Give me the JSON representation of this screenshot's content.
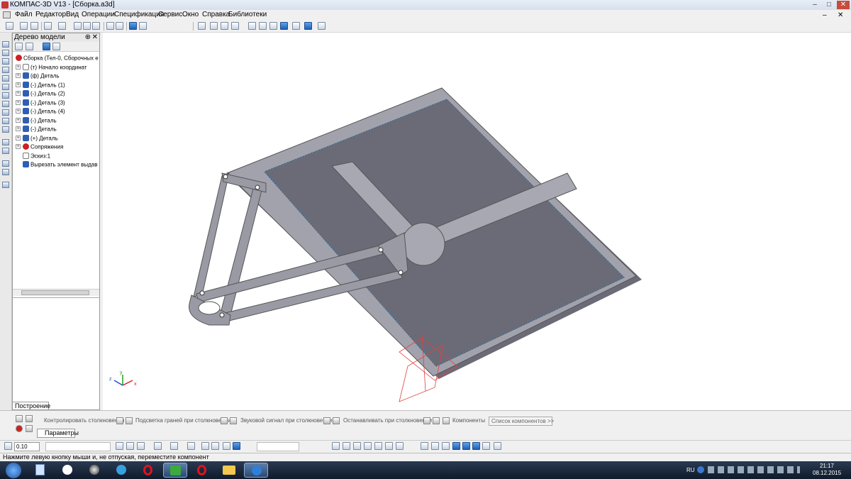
{
  "window": {
    "title": "КОМПАС-3D V13 - [Сборка.a3d]"
  },
  "menu": [
    "Файл",
    "Редактор",
    "Вид",
    "Операции",
    "Спецификация",
    "Сервис",
    "Окно",
    "Справка",
    "Библиотеки"
  ],
  "tree": {
    "header": "Дерево модели",
    "items": [
      {
        "expander": "",
        "label": "Сборка (Тел-0, Сборочных е"
      },
      {
        "expander": "+",
        "label": "(т) Начало координат"
      },
      {
        "expander": "+",
        "label": "(ф) Деталь"
      },
      {
        "expander": "+",
        "label": "(-) Деталь (1)"
      },
      {
        "expander": "+",
        "label": "(-) Деталь (2)"
      },
      {
        "expander": "+",
        "label": "(-) Деталь (3)"
      },
      {
        "expander": "+",
        "label": "(-) Деталь (4)"
      },
      {
        "expander": "+",
        "label": "(-) Деталь"
      },
      {
        "expander": "+",
        "label": "(-) Деталь"
      },
      {
        "expander": "+",
        "label": "(+) Деталь"
      },
      {
        "expander": "+",
        "label": "Сопряжения"
      },
      {
        "expander": "",
        "label": "Эскиз:1"
      },
      {
        "expander": "",
        "label": "Вырезать элемент выдав"
      }
    ],
    "tab": "Построение"
  },
  "viewport": {
    "axes": {
      "x": "x",
      "y": "y",
      "z": "z"
    }
  },
  "properties": {
    "items": [
      "Контролировать столкновения",
      "Подсветка граней при столкновении",
      "Звуковой сигнал при столкновении",
      "Останавливать при столкновении",
      "Компоненты",
      "Список компонентов >>"
    ],
    "tab": "Параметры"
  },
  "bottom_toolbar": {
    "step_value": "0.10"
  },
  "status": {
    "message": "Нажмите левую кнопку мыши и, не отпуская, переместите компонент"
  },
  "taskbar": {
    "language": "RU",
    "time": "21:17",
    "date": "08.12.2015"
  }
}
